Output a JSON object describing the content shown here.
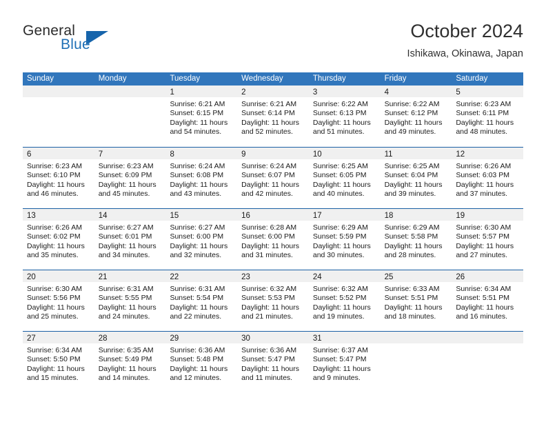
{
  "brand": {
    "name_top": "General",
    "name_bottom": "Blue",
    "accent_color": "#1664ab",
    "text_color": "#2b2b2b"
  },
  "header": {
    "title": "October 2024",
    "subtitle": "Ishikawa, Okinawa, Japan"
  },
  "calendar": {
    "header_bg": "#3176bc",
    "row_divider_color": "#1a5fa4",
    "day_strip_bg": "#f0f0f0",
    "weekdays": [
      "Sunday",
      "Monday",
      "Tuesday",
      "Wednesday",
      "Thursday",
      "Friday",
      "Saturday"
    ],
    "weeks": [
      [
        {
          "day": "",
          "empty": true
        },
        {
          "day": "",
          "empty": true
        },
        {
          "day": "1",
          "sunrise": "Sunrise: 6:21 AM",
          "sunset": "Sunset: 6:15 PM",
          "daylight_line1": "Daylight: 11 hours",
          "daylight_line2": "and 54 minutes."
        },
        {
          "day": "2",
          "sunrise": "Sunrise: 6:21 AM",
          "sunset": "Sunset: 6:14 PM",
          "daylight_line1": "Daylight: 11 hours",
          "daylight_line2": "and 52 minutes."
        },
        {
          "day": "3",
          "sunrise": "Sunrise: 6:22 AM",
          "sunset": "Sunset: 6:13 PM",
          "daylight_line1": "Daylight: 11 hours",
          "daylight_line2": "and 51 minutes."
        },
        {
          "day": "4",
          "sunrise": "Sunrise: 6:22 AM",
          "sunset": "Sunset: 6:12 PM",
          "daylight_line1": "Daylight: 11 hours",
          "daylight_line2": "and 49 minutes."
        },
        {
          "day": "5",
          "sunrise": "Sunrise: 6:23 AM",
          "sunset": "Sunset: 6:11 PM",
          "daylight_line1": "Daylight: 11 hours",
          "daylight_line2": "and 48 minutes."
        }
      ],
      [
        {
          "day": "6",
          "sunrise": "Sunrise: 6:23 AM",
          "sunset": "Sunset: 6:10 PM",
          "daylight_line1": "Daylight: 11 hours",
          "daylight_line2": "and 46 minutes."
        },
        {
          "day": "7",
          "sunrise": "Sunrise: 6:23 AM",
          "sunset": "Sunset: 6:09 PM",
          "daylight_line1": "Daylight: 11 hours",
          "daylight_line2": "and 45 minutes."
        },
        {
          "day": "8",
          "sunrise": "Sunrise: 6:24 AM",
          "sunset": "Sunset: 6:08 PM",
          "daylight_line1": "Daylight: 11 hours",
          "daylight_line2": "and 43 minutes."
        },
        {
          "day": "9",
          "sunrise": "Sunrise: 6:24 AM",
          "sunset": "Sunset: 6:07 PM",
          "daylight_line1": "Daylight: 11 hours",
          "daylight_line2": "and 42 minutes."
        },
        {
          "day": "10",
          "sunrise": "Sunrise: 6:25 AM",
          "sunset": "Sunset: 6:05 PM",
          "daylight_line1": "Daylight: 11 hours",
          "daylight_line2": "and 40 minutes."
        },
        {
          "day": "11",
          "sunrise": "Sunrise: 6:25 AM",
          "sunset": "Sunset: 6:04 PM",
          "daylight_line1": "Daylight: 11 hours",
          "daylight_line2": "and 39 minutes."
        },
        {
          "day": "12",
          "sunrise": "Sunrise: 6:26 AM",
          "sunset": "Sunset: 6:03 PM",
          "daylight_line1": "Daylight: 11 hours",
          "daylight_line2": "and 37 minutes."
        }
      ],
      [
        {
          "day": "13",
          "sunrise": "Sunrise: 6:26 AM",
          "sunset": "Sunset: 6:02 PM",
          "daylight_line1": "Daylight: 11 hours",
          "daylight_line2": "and 35 minutes."
        },
        {
          "day": "14",
          "sunrise": "Sunrise: 6:27 AM",
          "sunset": "Sunset: 6:01 PM",
          "daylight_line1": "Daylight: 11 hours",
          "daylight_line2": "and 34 minutes."
        },
        {
          "day": "15",
          "sunrise": "Sunrise: 6:27 AM",
          "sunset": "Sunset: 6:00 PM",
          "daylight_line1": "Daylight: 11 hours",
          "daylight_line2": "and 32 minutes."
        },
        {
          "day": "16",
          "sunrise": "Sunrise: 6:28 AM",
          "sunset": "Sunset: 6:00 PM",
          "daylight_line1": "Daylight: 11 hours",
          "daylight_line2": "and 31 minutes."
        },
        {
          "day": "17",
          "sunrise": "Sunrise: 6:29 AM",
          "sunset": "Sunset: 5:59 PM",
          "daylight_line1": "Daylight: 11 hours",
          "daylight_line2": "and 30 minutes."
        },
        {
          "day": "18",
          "sunrise": "Sunrise: 6:29 AM",
          "sunset": "Sunset: 5:58 PM",
          "daylight_line1": "Daylight: 11 hours",
          "daylight_line2": "and 28 minutes."
        },
        {
          "day": "19",
          "sunrise": "Sunrise: 6:30 AM",
          "sunset": "Sunset: 5:57 PM",
          "daylight_line1": "Daylight: 11 hours",
          "daylight_line2": "and 27 minutes."
        }
      ],
      [
        {
          "day": "20",
          "sunrise": "Sunrise: 6:30 AM",
          "sunset": "Sunset: 5:56 PM",
          "daylight_line1": "Daylight: 11 hours",
          "daylight_line2": "and 25 minutes."
        },
        {
          "day": "21",
          "sunrise": "Sunrise: 6:31 AM",
          "sunset": "Sunset: 5:55 PM",
          "daylight_line1": "Daylight: 11 hours",
          "daylight_line2": "and 24 minutes."
        },
        {
          "day": "22",
          "sunrise": "Sunrise: 6:31 AM",
          "sunset": "Sunset: 5:54 PM",
          "daylight_line1": "Daylight: 11 hours",
          "daylight_line2": "and 22 minutes."
        },
        {
          "day": "23",
          "sunrise": "Sunrise: 6:32 AM",
          "sunset": "Sunset: 5:53 PM",
          "daylight_line1": "Daylight: 11 hours",
          "daylight_line2": "and 21 minutes."
        },
        {
          "day": "24",
          "sunrise": "Sunrise: 6:32 AM",
          "sunset": "Sunset: 5:52 PM",
          "daylight_line1": "Daylight: 11 hours",
          "daylight_line2": "and 19 minutes."
        },
        {
          "day": "25",
          "sunrise": "Sunrise: 6:33 AM",
          "sunset": "Sunset: 5:51 PM",
          "daylight_line1": "Daylight: 11 hours",
          "daylight_line2": "and 18 minutes."
        },
        {
          "day": "26",
          "sunrise": "Sunrise: 6:34 AM",
          "sunset": "Sunset: 5:51 PM",
          "daylight_line1": "Daylight: 11 hours",
          "daylight_line2": "and 16 minutes."
        }
      ],
      [
        {
          "day": "27",
          "sunrise": "Sunrise: 6:34 AM",
          "sunset": "Sunset: 5:50 PM",
          "daylight_line1": "Daylight: 11 hours",
          "daylight_line2": "and 15 minutes."
        },
        {
          "day": "28",
          "sunrise": "Sunrise: 6:35 AM",
          "sunset": "Sunset: 5:49 PM",
          "daylight_line1": "Daylight: 11 hours",
          "daylight_line2": "and 14 minutes."
        },
        {
          "day": "29",
          "sunrise": "Sunrise: 6:36 AM",
          "sunset": "Sunset: 5:48 PM",
          "daylight_line1": "Daylight: 11 hours",
          "daylight_line2": "and 12 minutes."
        },
        {
          "day": "30",
          "sunrise": "Sunrise: 6:36 AM",
          "sunset": "Sunset: 5:47 PM",
          "daylight_line1": "Daylight: 11 hours",
          "daylight_line2": "and 11 minutes."
        },
        {
          "day": "31",
          "sunrise": "Sunrise: 6:37 AM",
          "sunset": "Sunset: 5:47 PM",
          "daylight_line1": "Daylight: 11 hours",
          "daylight_line2": "and 9 minutes."
        },
        {
          "day": "",
          "empty": true
        },
        {
          "day": "",
          "empty": true
        }
      ]
    ]
  }
}
